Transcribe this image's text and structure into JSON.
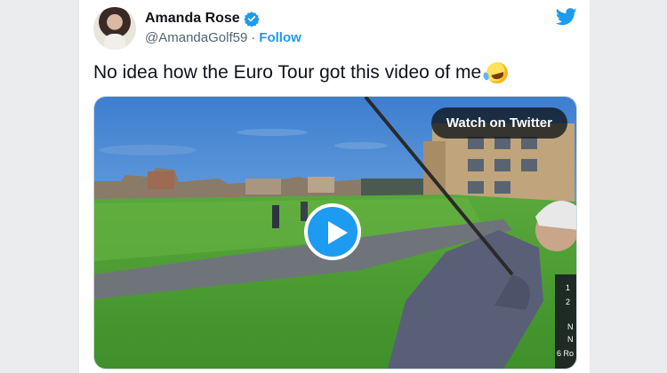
{
  "author": {
    "name": "Amanda Rose",
    "handle": "@AmandaGolf59",
    "separator": "·",
    "follow_label": "Follow"
  },
  "tweet": {
    "text": "No idea how the Euro Tour got this video of me",
    "emoji": "rolling-on-floor-laughing-emoji"
  },
  "media": {
    "watch_label": "Watch on Twitter",
    "scoreboard_digits": [
      "1",
      "2",
      "N",
      "N",
      "6 Ro"
    ]
  },
  "colors": {
    "twitter_blue": "#1d9bf0",
    "text_primary": "#0f1419",
    "text_secondary": "#536471"
  }
}
